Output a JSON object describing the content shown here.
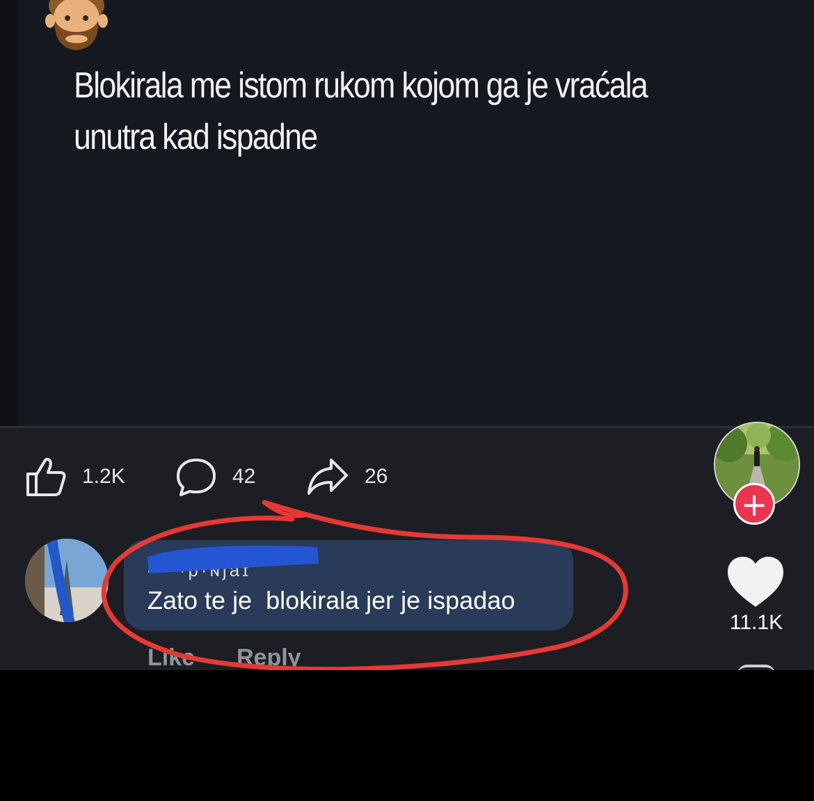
{
  "post": {
    "text_line1": "Blokirala me istom rukom kojom ga je vraćala",
    "text_line2": "unutra kad ispadne",
    "avatar_icon": "bearded-man-emoji"
  },
  "actions": {
    "like_count": "1.2K",
    "comment_count": "42",
    "share_count": "26"
  },
  "sidebar": {
    "follow_symbol": "+",
    "heart_count": "11.1K",
    "accent_color": "#e9364e"
  },
  "comment": {
    "author_visible": "· ·  ·p·ɴjaɪ",
    "text": "Zato te je  blokirala jer je ispadao",
    "like_label": "Like",
    "reply_label": "Reply",
    "bubble_color": "#293b58",
    "annotation_color": "#e53935"
  }
}
